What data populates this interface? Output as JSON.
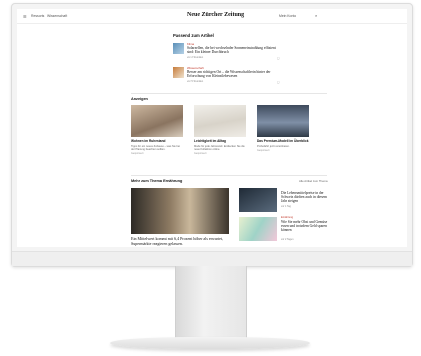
{
  "header": {
    "menu_icon": "menu-icon",
    "section1": "Ressorts",
    "section2": "Wissenschaft",
    "logo": "Neue Zürcher Zeitung",
    "account": "Mein Konto",
    "search_icon": "search-icon",
    "bookmark_icon": "bookmark-icon"
  },
  "popular": {
    "title": "Passend zum Artikel",
    "items": [
      {
        "tag": "Klima",
        "headline": "Solarzellen, die bei wechselnder Sonneneinstrahlung effizient sind: Ein kleiner Durchbruch",
        "meta": "vor 2 Stunden",
        "bookmark": "◻"
      },
      {
        "tag": "Wissenschaft",
        "headline": "Besser am richtigen Ort – die Wissenschaftlerin hinter der Erforschung von Kleinstlebewesen",
        "meta": "vor 5 Stunden",
        "bookmark": "◻"
      }
    ]
  },
  "ads": {
    "label": "Anzeigen",
    "items": [
      {
        "title": "Wohnen im Ruhestand",
        "desc": "Tipps für ein neues Zuhause – was Sie bei der Planung beachten sollten.",
        "source": "Gesponsert"
      },
      {
        "title": "Leichtigkeit im Alltag",
        "desc": "Mode für jede Jahreszeit: Entdecken Sie die neue Kollektion online.",
        "source": "Gesponsert"
      },
      {
        "title": "Das Premium-Modell im Überblick",
        "desc": "Probefahrt jetzt vereinbaren.",
        "source": "Gesponsert"
      }
    ]
  },
  "more": {
    "label": "Mehr zum Thema Ernährung",
    "link": "Alle Artikel zum Thema",
    "big_headline": "Ein Mittelwert kommt mit 6,4 Prozent höher als erwartet, Supermärkte reagieren gelassen.",
    "right": [
      {
        "tag": "",
        "headline": "Die Lebensmittelpreise in der Schweiz dürften auch in diesem Jahr steigen",
        "meta": "vor 1 Tag"
      },
      {
        "tag": "Ernährung",
        "headline": "Wie Sie mehr Obst und Gemüse essen und trotzdem Geld sparen können",
        "meta": "vor 2 Tagen"
      }
    ]
  },
  "colors": {
    "accent": "#c0392b"
  }
}
